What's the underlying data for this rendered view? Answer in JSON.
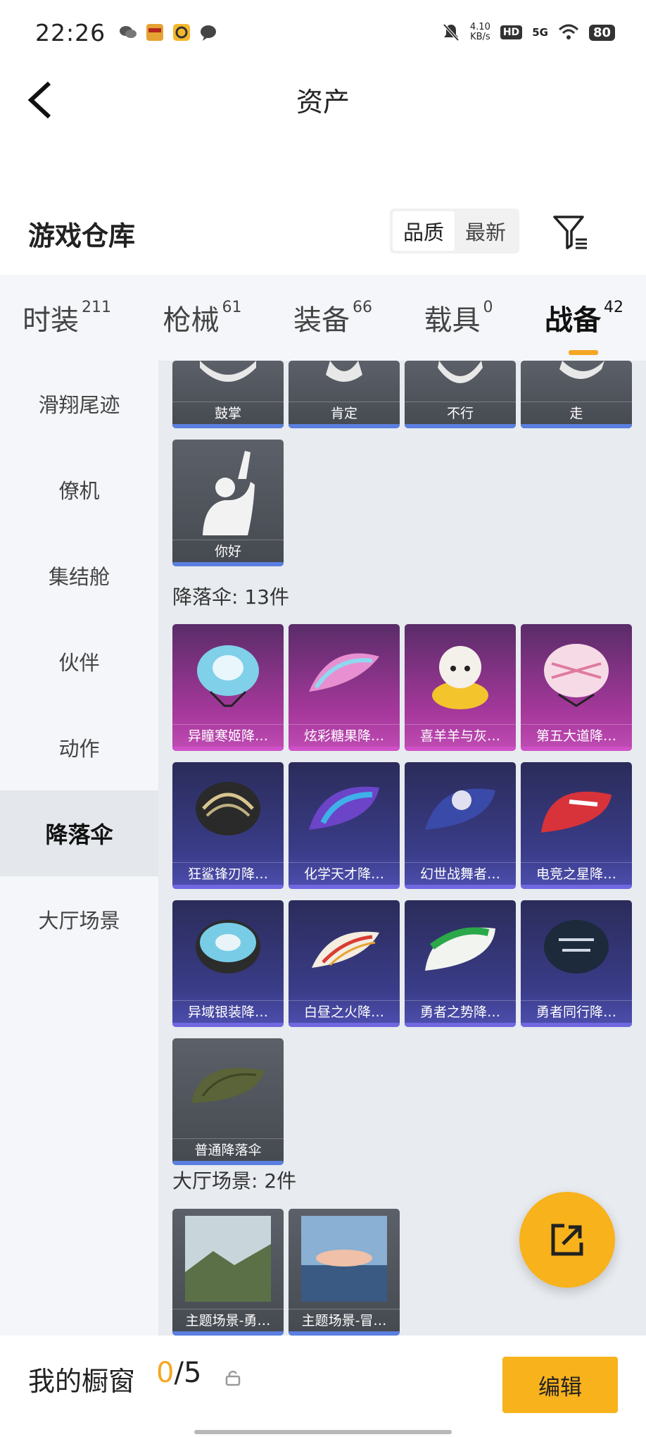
{
  "status_bar": {
    "time": "22:26",
    "net_speed_value": "4.10",
    "net_speed_unit": "KB/s",
    "hd": "HD",
    "network": "5G",
    "battery": "80"
  },
  "header": {
    "title": "资产"
  },
  "warehouse": {
    "title": "游戏仓库",
    "sort_options": [
      "品质",
      "最新"
    ],
    "active_sort": "品质"
  },
  "tabs": [
    {
      "label": "时装",
      "count": "211"
    },
    {
      "label": "枪械",
      "count": "61"
    },
    {
      "label": "装备",
      "count": "66"
    },
    {
      "label": "载具",
      "count": "0"
    },
    {
      "label": "战备",
      "count": "42"
    }
  ],
  "active_tab": "战备",
  "sidebar": [
    {
      "label": "滑翔尾迹"
    },
    {
      "label": "僚机"
    },
    {
      "label": "集结舱"
    },
    {
      "label": "伙伴"
    },
    {
      "label": "动作"
    },
    {
      "label": "降落伞"
    },
    {
      "label": "大厅场景"
    }
  ],
  "active_sidebar": "降落伞",
  "emotes": [
    "鼓掌",
    "肯定",
    "不行",
    "走",
    "你好"
  ],
  "parachutes_title": "降落伞: 13件",
  "parachutes": [
    "异瞳寒姬降…",
    "炫彩糖果降…",
    "喜羊羊与灰…",
    "第五大道降…",
    "狂鲨锋刃降…",
    "化学天才降…",
    "幻世战舞者…",
    "电竞之星降…",
    "异域银装降…",
    "白昼之火降…",
    "勇者之势降…",
    "勇者同行降…",
    "普通降落伞"
  ],
  "lobby_title": "大厅场景: 2件",
  "lobby_scenes": [
    "主题场景-勇…",
    "主题场景-冒…"
  ],
  "showcase": {
    "title": "我的橱窗",
    "current": "0",
    "separator": "/",
    "max": "5",
    "edit_label": "编辑"
  }
}
